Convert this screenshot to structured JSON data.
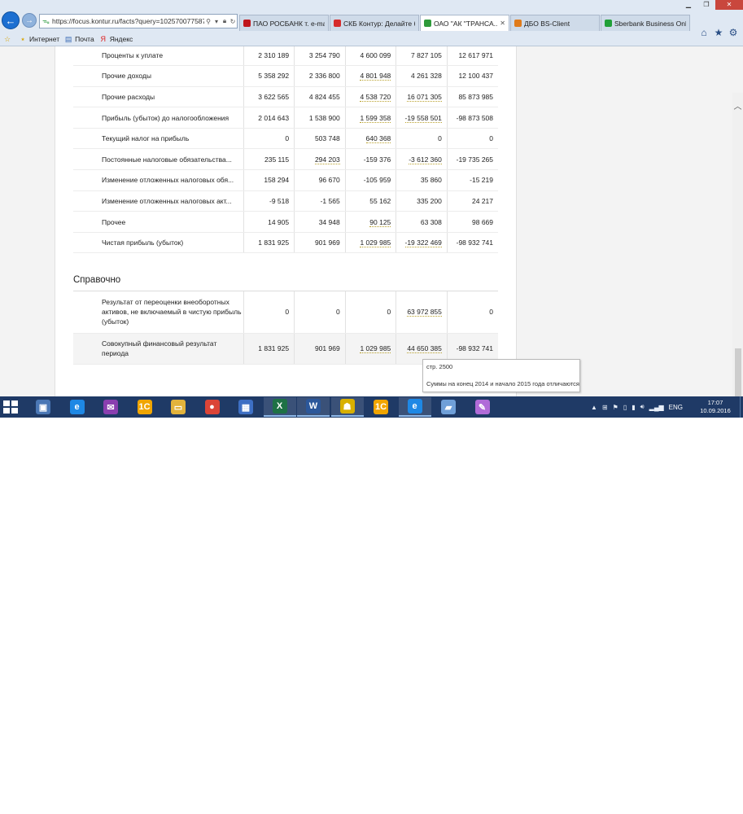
{
  "browser": {
    "address": "https://focus.kontur.ru/facts?query=102570077587(",
    "tabs": [
      {
        "label": "ПАО РОСБАНК т. e-ma...",
        "icon_color": "#c0161c",
        "active": false
      },
      {
        "label": "СКБ Контур: Делайте б...",
        "icon_color": "#d62b2b",
        "active": false
      },
      {
        "label": "ОАО \"АК \"ТРАНСА...",
        "icon_color": "#2e9a3a",
        "active": true
      },
      {
        "label": "ДБО BS-Client",
        "icon_color": "#e07b1a",
        "active": false
      },
      {
        "label": "Sberbank Business Onli...",
        "icon_color": "#21a038",
        "active": false
      }
    ],
    "favorites": [
      {
        "label": "Интернет",
        "icon": "star-icon"
      },
      {
        "label": "Почта",
        "icon": "mail-icon"
      },
      {
        "label": "Яндекс",
        "icon": "yandex-icon"
      }
    ]
  },
  "table_main": {
    "rows": [
      {
        "label": "Проценты к уплате",
        "values": [
          "2 310 189",
          "3 254 790",
          "4 600 099",
          "7 827 105",
          "12 617 971"
        ],
        "dotted": [
          false,
          false,
          false,
          false,
          false
        ]
      },
      {
        "label": "Прочие доходы",
        "values": [
          "5 358 292",
          "2 336 800",
          "4 801 948",
          "4 261 328",
          "12 100 437"
        ],
        "dotted": [
          false,
          false,
          true,
          false,
          false
        ]
      },
      {
        "label": "Прочие расходы",
        "values": [
          "3 622 565",
          "4 824 455",
          "4 538 720",
          "16 071 305",
          "85 873 985"
        ],
        "dotted": [
          false,
          false,
          true,
          true,
          false
        ]
      },
      {
        "label": "Прибыль (убыток) до налогообложения",
        "values": [
          "2 014 643",
          "1 538 900",
          "1 599 358",
          "-19 558 501",
          "-98 873 508"
        ],
        "dotted": [
          false,
          false,
          true,
          true,
          false
        ]
      },
      {
        "label": "Текущий налог на прибыль",
        "values": [
          "0",
          "503 748",
          "640 368",
          "0",
          "0"
        ],
        "dotted": [
          false,
          false,
          true,
          false,
          false
        ]
      },
      {
        "label": "Постоянные налоговые обязательства...",
        "values": [
          "235 115",
          "294 203",
          "-159 376",
          "-3 612 360",
          "-19 735 265"
        ],
        "dotted": [
          false,
          true,
          false,
          true,
          false
        ]
      },
      {
        "label": "Изменение отложенных налоговых обя...",
        "values": [
          "158 294",
          "96 670",
          "-105 959",
          "35 860",
          "-15 219"
        ],
        "dotted": [
          false,
          false,
          false,
          false,
          false
        ]
      },
      {
        "label": "Изменение отложенных налоговых акт...",
        "values": [
          "-9 518",
          "-1 565",
          "55 162",
          "335 200",
          "24 217"
        ],
        "dotted": [
          false,
          false,
          false,
          false,
          false
        ]
      },
      {
        "label": "Прочее",
        "values": [
          "14 905",
          "34 948",
          "90 125",
          "63 308",
          "98 669"
        ],
        "dotted": [
          false,
          false,
          true,
          false,
          false
        ]
      },
      {
        "label": "Чистая прибыль (убыток)",
        "values": [
          "1 831 925",
          "901 969",
          "1 029 985",
          "-19 322 469",
          "-98 932 741"
        ],
        "dotted": [
          false,
          false,
          true,
          true,
          false
        ]
      }
    ]
  },
  "reference": {
    "title": "Справочно",
    "rows": [
      {
        "label": "Результат от переоценки внеоборотных активов, не включаемый в чистую прибыль (убыток)",
        "values": [
          "0",
          "0",
          "0",
          "63 972 855",
          "0"
        ],
        "dotted": [
          false,
          false,
          false,
          true,
          false
        ]
      },
      {
        "label": "Совокупный финансовый результат периода",
        "values": [
          "1 831 925",
          "901 969",
          "1 029 985",
          "44 650 385",
          "-98 932 741"
        ],
        "dotted": [
          false,
          false,
          true,
          true,
          false
        ]
      }
    ]
  },
  "tooltip": {
    "line1": "стр. 2500",
    "line2": "Суммы на конец 2014 и начало 2015 года отличаются"
  },
  "taskbar": {
    "apps": [
      {
        "name": "server-manager-icon",
        "glyph": "▣",
        "color": "#4a77b5",
        "open": false
      },
      {
        "name": "ie-icon",
        "glyph": "e",
        "color": "#1e88e5",
        "open": false
      },
      {
        "name": "app-purple-icon",
        "glyph": "✉",
        "color": "#8a3fb0",
        "open": false
      },
      {
        "name": "1c-icon",
        "glyph": "1C",
        "color": "#f0a500",
        "open": false
      },
      {
        "name": "explorer-icon",
        "glyph": "▭",
        "color": "#e2b33c",
        "open": false
      },
      {
        "name": "chrome-icon",
        "glyph": "●",
        "color": "#db4437",
        "open": false
      },
      {
        "name": "remote-desktop-icon",
        "glyph": "▦",
        "color": "#3d6fc4",
        "open": false
      },
      {
        "name": "excel-icon",
        "glyph": "X",
        "color": "#1e7145",
        "open": true
      },
      {
        "name": "word-icon",
        "glyph": "W",
        "color": "#2b579a",
        "open": true
      },
      {
        "name": "bank-client-icon",
        "glyph": "☗",
        "color": "#d8b000",
        "open": true
      },
      {
        "name": "1c-icon-2",
        "glyph": "1C",
        "color": "#f0a500",
        "open": false
      },
      {
        "name": "ie-open-icon",
        "glyph": "e",
        "color": "#1e88e5",
        "open": true
      },
      {
        "name": "notepad-icon",
        "glyph": "▰",
        "color": "#6f9fd8",
        "open": false
      },
      {
        "name": "paint-icon",
        "glyph": "✎",
        "color": "#b06bd8",
        "open": false
      }
    ],
    "lang": "ENG",
    "time": "17:07",
    "date": "10.09.2016"
  }
}
